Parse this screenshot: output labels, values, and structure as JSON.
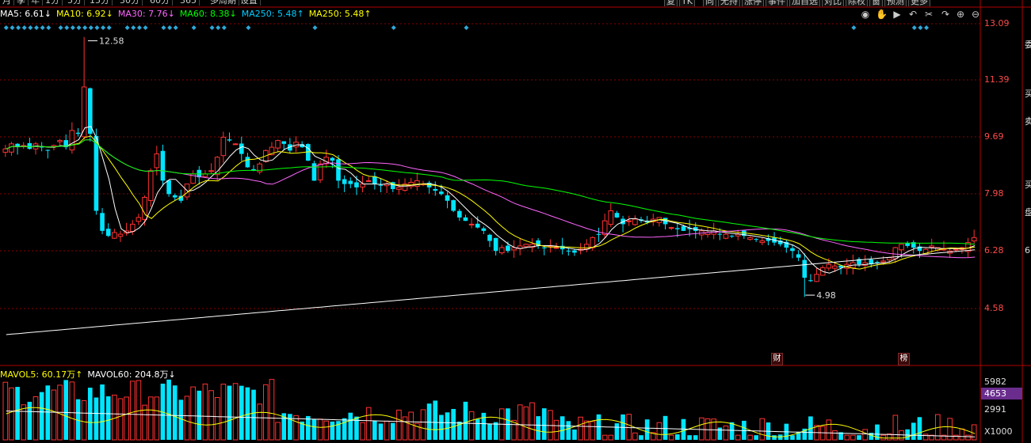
{
  "toolbar": {
    "periods": [
      "月",
      "季",
      "年",
      "1分",
      "5分",
      "15分",
      "30分",
      "60分",
      "365",
      "多周期",
      "设置"
    ],
    "tools": [
      "复",
      "TK",
      "同",
      "无持",
      "涨停",
      "事件",
      "加自选",
      "对比",
      "除权",
      "窗",
      "预测",
      "更多"
    ]
  },
  "ma_legend": [
    {
      "label": "MA5: 6.61↓",
      "color": "#ffffff"
    },
    {
      "label": "MA10: 6.92↓",
      "color": "#ffff00"
    },
    {
      "label": "MA30: 7.76↓",
      "color": "#ff66ff"
    },
    {
      "label": "MA60: 8.38↓",
      "color": "#00ff00"
    },
    {
      "label": "MA250: 5.48↑",
      "color": "#00ccff"
    },
    {
      "label": "MA250: 5.48↑",
      "color": "#ffff00"
    }
  ],
  "vol_legend": [
    {
      "label": "MAVOL5: 60.17万↑",
      "color": "#ffff00"
    },
    {
      "label": "MAVOL60: 204.8万↓",
      "color": "#ffffff"
    }
  ],
  "side_text": [
    "委",
    "买",
    "卖",
    "买",
    "盘",
    "6"
  ],
  "events": [
    "财",
    "榜"
  ],
  "colors": {
    "up": "#ff3232",
    "down": "#00e5ff",
    "ma5": "#ffffff",
    "ma10": "#ffff00",
    "ma30": "#ff66ff",
    "ma60": "#00ff00",
    "ma250": "#ffffff",
    "grid": "#8b0000",
    "volcur": "#6a2d8e"
  },
  "chart_data": {
    "type": "candlestick",
    "price_axis": {
      "ticks": [
        "13.09",
        "11.39",
        "9.69",
        "7.98",
        "6.28",
        "4.58"
      ],
      "ylim": [
        4.58,
        13.09
      ]
    },
    "annotations": {
      "high": "12.58",
      "low": "4.98"
    },
    "volume_axis": {
      "ticks": [
        "5982",
        "4653",
        "2991",
        "X1000"
      ],
      "current": "4653"
    },
    "closes": [
      9.35,
      9.5,
      9.4,
      9.45,
      9.35,
      9.5,
      9.4,
      9.3,
      9.45,
      9.6,
      9.4,
      9.9,
      9.8,
      11.2,
      9.8,
      7.5,
      6.9,
      6.75,
      6.85,
      6.8,
      6.9,
      7.1,
      7.3,
      7.9,
      8.7,
      9.2,
      8.4,
      8.0,
      7.9,
      7.8,
      8.3,
      8.6,
      8.5,
      8.6,
      8.7,
      9.1,
      9.7,
      9.6,
      9.5,
      9.2,
      8.8,
      8.7,
      8.9,
      9.3,
      9.4,
      9.6,
      9.5,
      9.3,
      9.55,
      9.4,
      9.0,
      8.4,
      8.9,
      9.1,
      9.0,
      8.4,
      8.3,
      8.3,
      8.2,
      8.3,
      8.4,
      8.3,
      8.25,
      8.3,
      8.15,
      8.2,
      8.3,
      8.35,
      8.4,
      8.3,
      8.2,
      8.1,
      8.0,
      7.8,
      7.5,
      7.3,
      7.2,
      7.1,
      7.0,
      6.9,
      6.6,
      6.3,
      6.4,
      6.3,
      6.4,
      6.45,
      6.5,
      6.5,
      6.45,
      6.4,
      6.45,
      6.4,
      6.35,
      6.3,
      6.25,
      6.35,
      6.5,
      6.7,
      6.8,
      7.2,
      7.5,
      7.3,
      7.1,
      7.2,
      7.25,
      7.2,
      7.15,
      7.25,
      7.3,
      7.1,
      7.0,
      6.95,
      6.9,
      6.95,
      6.9,
      6.9,
      6.85,
      6.9,
      6.8,
      6.8,
      6.75,
      6.8,
      6.75,
      6.7,
      6.65,
      6.6,
      6.6,
      6.55,
      6.5,
      6.4,
      6.3,
      6.1,
      5.5,
      5.4,
      5.6,
      5.8,
      5.9,
      5.85,
      5.8,
      5.9,
      5.95,
      5.9,
      5.95,
      5.9,
      5.95,
      6.0,
      6.1,
      6.4,
      6.5,
      6.45,
      6.4,
      6.3,
      6.35,
      6.45,
      6.4,
      6.35,
      6.3,
      6.35,
      6.4,
      6.55,
      6.7
    ]
  }
}
